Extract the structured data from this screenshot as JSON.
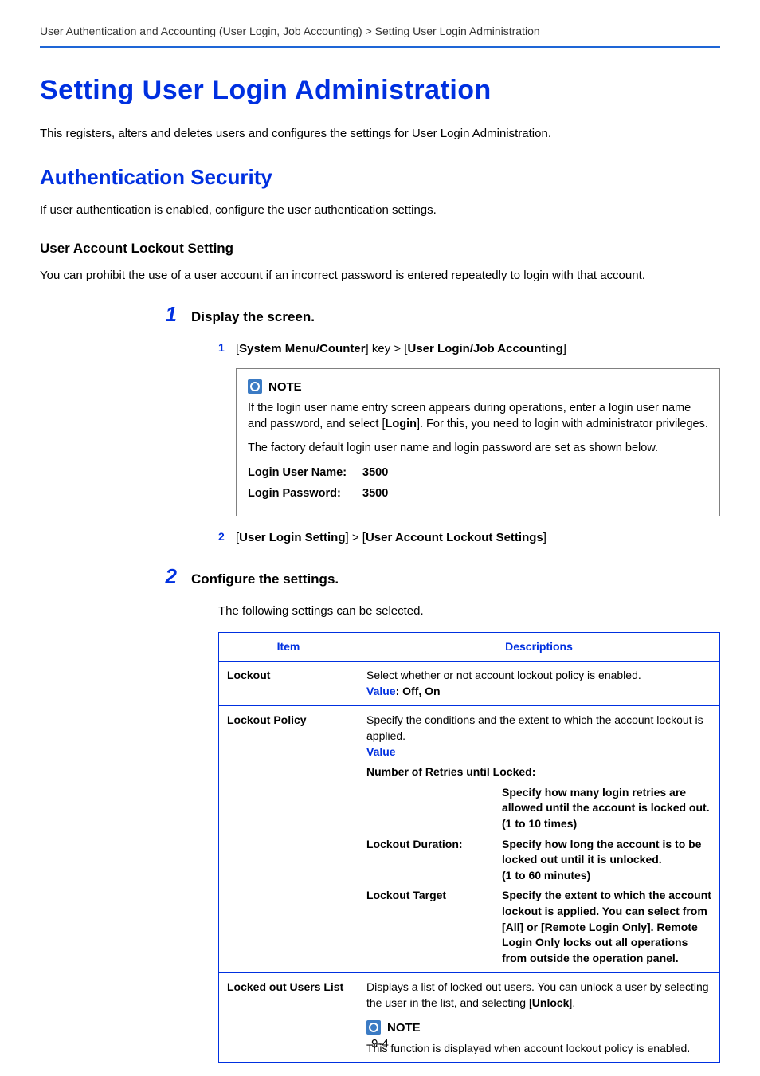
{
  "breadcrumb": "User Authentication and Accounting (User Login, Job Accounting) > Setting User Login Administration",
  "h1": "Setting User Login Administration",
  "intro": "This registers, alters and deletes users and configures the settings for User Login Administration.",
  "h2": "Authentication Security",
  "auth_intro": "If user authentication is enabled, configure the user authentication settings.",
  "h3": "User Account Lockout Setting",
  "lockout_intro": "You can prohibit the use of a user account if an incorrect password is entered repeatedly to login with that account.",
  "step1": {
    "num": "1",
    "title": "Display the screen.",
    "sub1": {
      "num": "1",
      "pre": "[",
      "a": "System Menu/Counter",
      "mid": "] key > [",
      "b": "User Login/Job Accounting",
      "post": "]"
    },
    "note": {
      "label": "NOTE",
      "p1a": "If the login user name entry screen appears during operations, enter a login user name and password, and select [",
      "p1b": "Login",
      "p1c": "]. For this, you need to login with administrator privileges.",
      "p2": "The factory default login user name and login password are set as shown below.",
      "lun_label": "Login User Name:",
      "lun_val": "3500",
      "lpw_label": "Login Password:",
      "lpw_val": "3500"
    },
    "sub2": {
      "num": "2",
      "pre": "[",
      "a": "User Login Setting",
      "mid": "] > [",
      "b": "User Account Lockout Settings",
      "post": "]"
    }
  },
  "step2": {
    "num": "2",
    "title": "Configure the settings.",
    "intro": "The following settings can be selected."
  },
  "table": {
    "headers": {
      "item": "Item",
      "desc": "Descriptions"
    },
    "rows": [
      {
        "item": "Lockout",
        "desc": "Select whether or not account lockout policy is enabled.",
        "value_label": "Value",
        "value_text": ": Off, On"
      },
      {
        "item": "Lockout Policy",
        "desc": "Specify the conditions and the extent to which the account lockout is applied.",
        "value_label": "Value",
        "subs": [
          {
            "k": "Number of Retries until Locked:",
            "v1": "Specify how many login retries are allowed until the account is locked out.",
            "v2": "(1 to 10 times)"
          },
          {
            "k": "Lockout Duration:",
            "v1": "Specify how long the account is to be locked out until it is unlocked.",
            "v2": "(1 to 60 minutes)"
          },
          {
            "k": "Lockout Target",
            "v1": "Specify the extent to which the account lockout is applied. You can select from [All] or [Remote Login Only]. Remote Login Only locks out all operations from outside the operation panel.",
            "v2": ""
          }
        ]
      },
      {
        "item": "Locked out Users List",
        "desc_a": "Displays a list of locked out users. You can unlock a user by selecting the user in the list, and selecting [",
        "desc_b": "Unlock",
        "desc_c": "].",
        "note_label": "NOTE",
        "note_text": "This function is displayed when account lockout policy is enabled."
      }
    ]
  },
  "page_num": "9-4"
}
